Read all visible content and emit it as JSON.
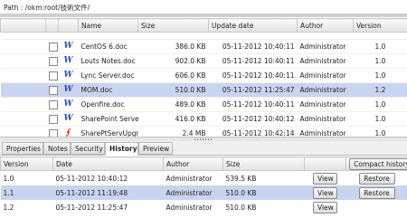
{
  "path_bar": {
    "label": "Path : /okm:root/技術文件/"
  },
  "file_table": {
    "headers": {
      "name": "Name",
      "size": "Size",
      "date": "Update date",
      "author": "Author",
      "version": "Version"
    },
    "rows": [
      {
        "name": "CentOS 6.doc",
        "icon": "word-icon",
        "size": "386.0 KB",
        "date": "05-11-2012 10:40:11",
        "author": "Administrator",
        "version": "1.0",
        "selected": false
      },
      {
        "name": "Louts Notes.doc",
        "icon": "word-icon",
        "size": "902.0 KB",
        "date": "05-11-2012 10:40:11",
        "author": "Administrator",
        "version": "1.0",
        "selected": false
      },
      {
        "name": "Lync Server.doc",
        "icon": "word-icon",
        "size": "606.0 KB",
        "date": "05-11-2012 10:40:11",
        "author": "Administrator",
        "version": "1.0",
        "selected": false
      },
      {
        "name": "MOM.doc",
        "icon": "word-icon",
        "size": "510.0 KB",
        "date": "05-11-2012 11:25:47",
        "author": "Administrator",
        "version": "1.2",
        "selected": true
      },
      {
        "name": "Openfire.doc",
        "icon": "word-icon",
        "size": "489.0 KB",
        "date": "05-11-2012 10:40:11",
        "author": "Administrator",
        "version": "1.0",
        "selected": false
      },
      {
        "name": "SharePoint Serve",
        "icon": "word-icon",
        "size": "416.0 KB",
        "date": "05-11-2012 10:40:12",
        "author": "Administrator",
        "version": "1.0",
        "selected": false
      },
      {
        "name": "SharePtServUpgr",
        "icon": "pdf-icon",
        "size": "2.4 MB",
        "date": "05-11-2012 10:42:14",
        "author": "Administrator",
        "version": "1.0",
        "selected": false
      },
      {
        "name": "System Center.do",
        "icon": "word-icon",
        "size": "1.8 MB",
        "date": "05-11-2012 10:40:11",
        "author": "Administrator",
        "version": "1.0",
        "selected": false
      }
    ]
  },
  "tabs": [
    {
      "label": "Properties",
      "active": false
    },
    {
      "label": "Notes",
      "active": false
    },
    {
      "label": "Security",
      "active": false
    },
    {
      "label": "History",
      "active": true
    },
    {
      "label": "Preview",
      "active": false
    }
  ],
  "history": {
    "headers": {
      "version": "Version",
      "date": "Date",
      "author": "Author",
      "size": "Size"
    },
    "compact_button": "Compact history",
    "view_label": "View",
    "restore_label": "Restore",
    "rows": [
      {
        "version": "1.0",
        "date": "05-11-2012 10:40:12",
        "author": "Administrator",
        "size": "539.5 KB",
        "restore": true,
        "selected": false
      },
      {
        "version": "1.1",
        "date": "05-11-2012 11:19:48",
        "author": "Administrator",
        "size": "510.0 KB",
        "restore": true,
        "selected": true
      },
      {
        "version": "1.2",
        "date": "05-11-2012 11:25:47",
        "author": "Administrator",
        "size": "510.0 KB",
        "restore": false,
        "selected": false
      }
    ]
  },
  "colors": {
    "selection": "#c8d4f0",
    "word_icon": "#2a4fb0",
    "pdf_icon": "#d02020"
  }
}
